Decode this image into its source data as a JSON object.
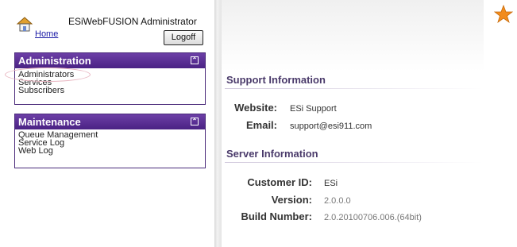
{
  "header": {
    "home_label": "Home",
    "app_title": "ESiWebFUSION Administrator",
    "logoff_label": "Logoff"
  },
  "sidebar": {
    "administration": {
      "title": "Administration",
      "items": [
        {
          "label": "Administrators"
        },
        {
          "label": "Services"
        },
        {
          "label": "Subscribers"
        }
      ]
    },
    "maintenance": {
      "title": "Maintenance",
      "items": [
        {
          "label": "Queue Management"
        },
        {
          "label": "Service Log"
        },
        {
          "label": "Web Log"
        }
      ]
    }
  },
  "support": {
    "title": "Support Information",
    "website_label": "Website:",
    "website_value": "ESi Support",
    "email_label": "Email:",
    "email_value": "support@esi911.com"
  },
  "server": {
    "title": "Server Information",
    "customer_label": "Customer ID:",
    "customer_value": "ESi",
    "version_label": "Version:",
    "version_value": "2.0.0.0",
    "build_label": "Build Number:",
    "build_value": "2.0.20100706.006.(64bit)"
  },
  "colors": {
    "panel_header": "#5a2f95",
    "section_title": "#4a3a6a",
    "star": "#f28c1e",
    "highlight": "#e9b7c2"
  },
  "icons": [
    "home-icon",
    "collapse-icon",
    "star-icon"
  ]
}
